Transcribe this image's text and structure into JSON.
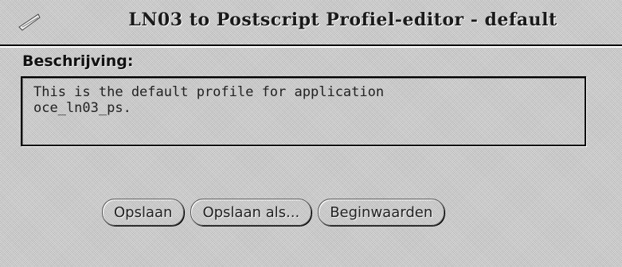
{
  "window": {
    "title": "LN03 to Postscript Profiel-editor - default",
    "menu_icon": "window-menu-icon"
  },
  "form": {
    "description_label": "Beschrijving:",
    "description_value": "This is the default profile for application\noce_ln03_ps."
  },
  "buttons": {
    "save_label": "Opslaan",
    "save_as_label": "Opslaan als...",
    "defaults_label": "Beginwaarden"
  },
  "colors": {
    "background": "#c8c8c8",
    "border": "#000000"
  }
}
